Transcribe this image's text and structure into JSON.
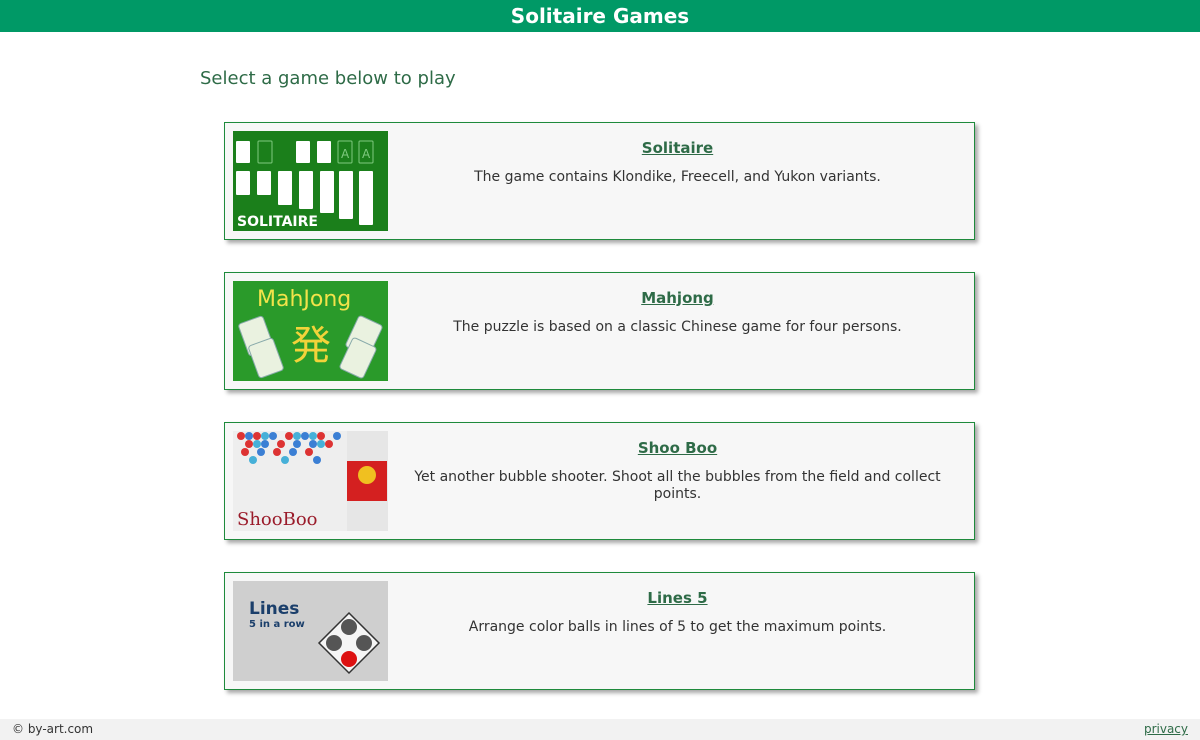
{
  "header": {
    "title": "Solitaire Games"
  },
  "intro": {
    "text": "Select a game below to play"
  },
  "games": [
    {
      "title": "Solitaire",
      "description": "The game contains Klondike, Freecell, and Yukon variants.",
      "thumb_label": "SOLITAIRE"
    },
    {
      "title": "Mahjong",
      "description": "The puzzle is based on a classic Chinese game for four persons.",
      "thumb_label": "MahJong"
    },
    {
      "title": "Shoo Boo",
      "description": "Yet another bubble shooter. Shoot all the bubbles from the field and collect points.",
      "thumb_label": "ShooBoo"
    },
    {
      "title": "Lines 5",
      "description": "Arrange color balls in lines of 5 to get the maximum points.",
      "thumb_label": "Lines",
      "thumb_sublabel": "5 in a row"
    }
  ],
  "footer": {
    "copyright": "© by-art.com",
    "privacy": "privacy"
  },
  "colors": {
    "brand": "#009966",
    "card_border": "#1e8a3c",
    "link": "#2e6b47"
  }
}
